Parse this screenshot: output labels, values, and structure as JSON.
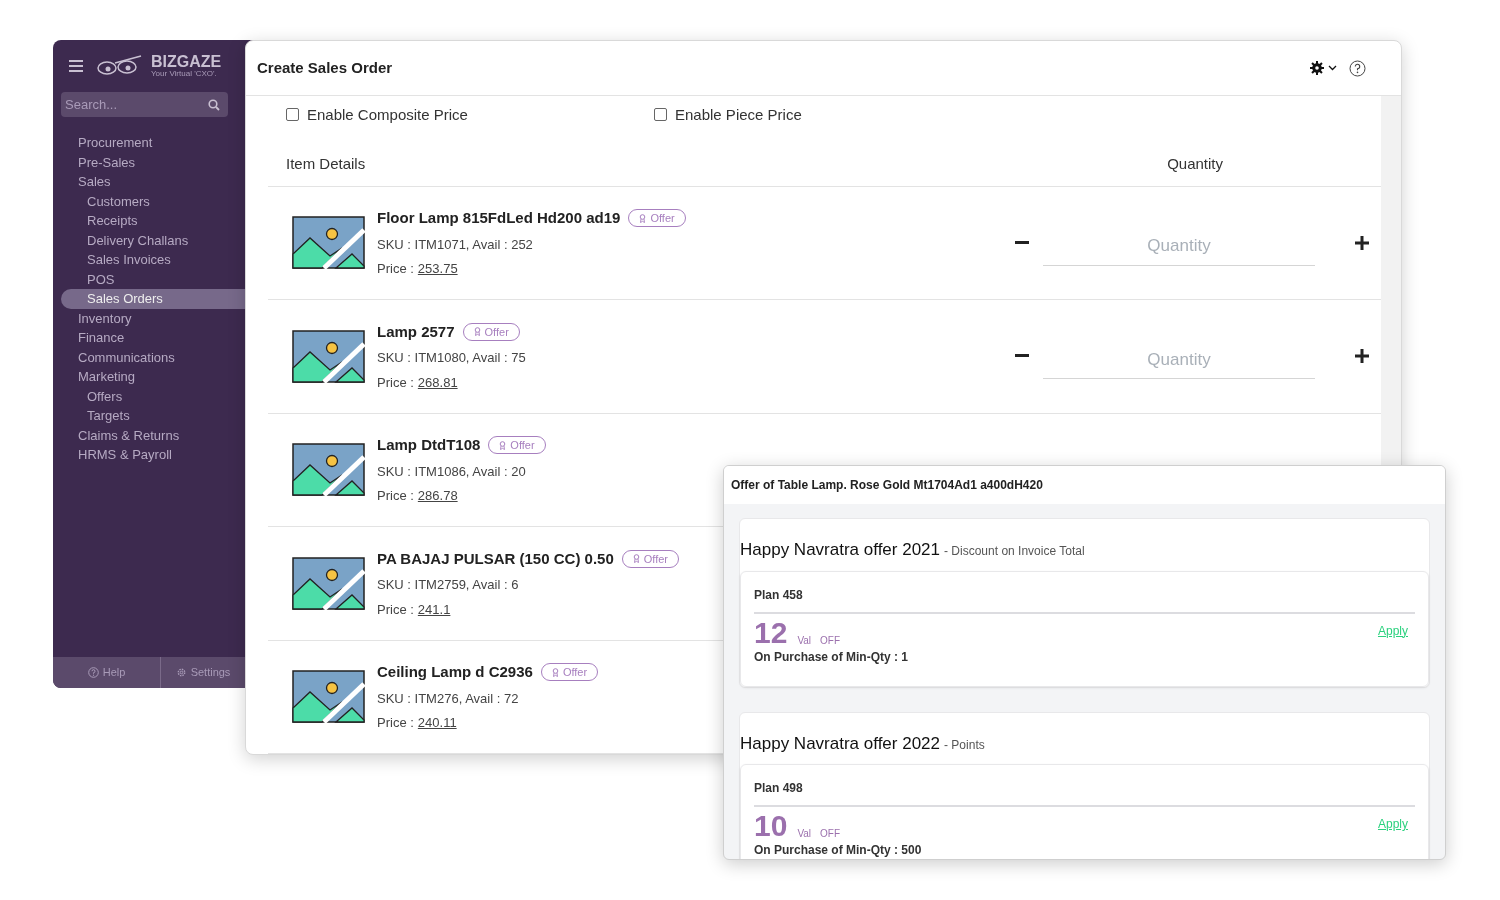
{
  "sidebar": {
    "brand": "BIZGAZE",
    "tagline": "Your Virtual 'CXO'.",
    "search": {
      "placeholder": "Search..."
    },
    "items": [
      {
        "label": "Procurement",
        "selected": false
      },
      {
        "label": "Pre-Sales",
        "selected": false
      },
      {
        "label": "Sales",
        "selected": false,
        "children": [
          {
            "label": "Customers",
            "selected": false
          },
          {
            "label": "Receipts",
            "selected": false
          },
          {
            "label": "Delivery Challans",
            "selected": false
          },
          {
            "label": "Sales Invoices",
            "selected": false
          },
          {
            "label": "POS",
            "selected": false
          },
          {
            "label": "Sales Orders",
            "selected": true
          }
        ]
      },
      {
        "label": "Inventory",
        "selected": false
      },
      {
        "label": "Finance",
        "selected": false
      },
      {
        "label": "Communications",
        "selected": false
      },
      {
        "label": "Marketing",
        "selected": false,
        "children": [
          {
            "label": "Offers",
            "selected": false
          },
          {
            "label": "Targets",
            "selected": false
          }
        ]
      },
      {
        "label": "Claims & Returns",
        "selected": false
      },
      {
        "label": "HRMS & Payroll",
        "selected": false
      }
    ],
    "footer": [
      "Help",
      "Settings"
    ]
  },
  "window": {
    "title": "Create Sales Order",
    "options": [
      {
        "label": "Enable Composite Price",
        "checked": false
      },
      {
        "label": "Enable Piece Price",
        "checked": false
      }
    ],
    "columns": [
      "Item Details",
      "Quantity"
    ],
    "items": [
      {
        "name": "Floor Lamp 815FdLed Hd200 ad19",
        "badge": "Offer",
        "sku": "SKU : ITM1071, Avail : 252",
        "price_label": "Price :",
        "price": "253.75",
        "quantity": {
          "placeholder": "Quantity"
        }
      },
      {
        "name": "Lamp 2577",
        "badge": "Offer",
        "sku": "SKU : ITM1080, Avail : 75",
        "price_label": "Price :",
        "price": "268.81",
        "quantity": {
          "placeholder": "Quantity"
        }
      },
      {
        "name": "Lamp DtdT108",
        "badge": "Offer",
        "sku": "SKU : ITM1086, Avail : 20",
        "price_label": "Price :",
        "price": "286.78"
      },
      {
        "name": "PA BAJAJ PULSAR (150 CC) 0.50",
        "badge": "Offer",
        "sku": "SKU : ITM2759, Avail : 6",
        "price_label": "Price :",
        "price": "241.1"
      },
      {
        "name": "Ceiling Lamp d C2936",
        "badge": "Offer",
        "sku": "SKU : ITM276, Avail : 72",
        "price_label": "Price :",
        "price": "240.11"
      }
    ]
  },
  "offer_popup": {
    "title": "Offer of Table Lamp. Rose Gold Mt1704Ad1 a400dH420",
    "offers": [
      {
        "name": "Happy Navratra offer 2021",
        "type": "- Discount on Invoice Total",
        "plan": "Plan 458",
        "value": "12",
        "unit": "Val",
        "off": "OFF",
        "condition": "On Purchase of Min-Qty : 1",
        "action": "Apply"
      },
      {
        "name": "Happy Navratra offer 2022",
        "type": "- Points",
        "plan": "Plan 498",
        "value": "10",
        "unit": "Val",
        "off": "OFF",
        "condition": "On Purchase of Min-Qty : 500",
        "action": "Apply"
      }
    ]
  }
}
